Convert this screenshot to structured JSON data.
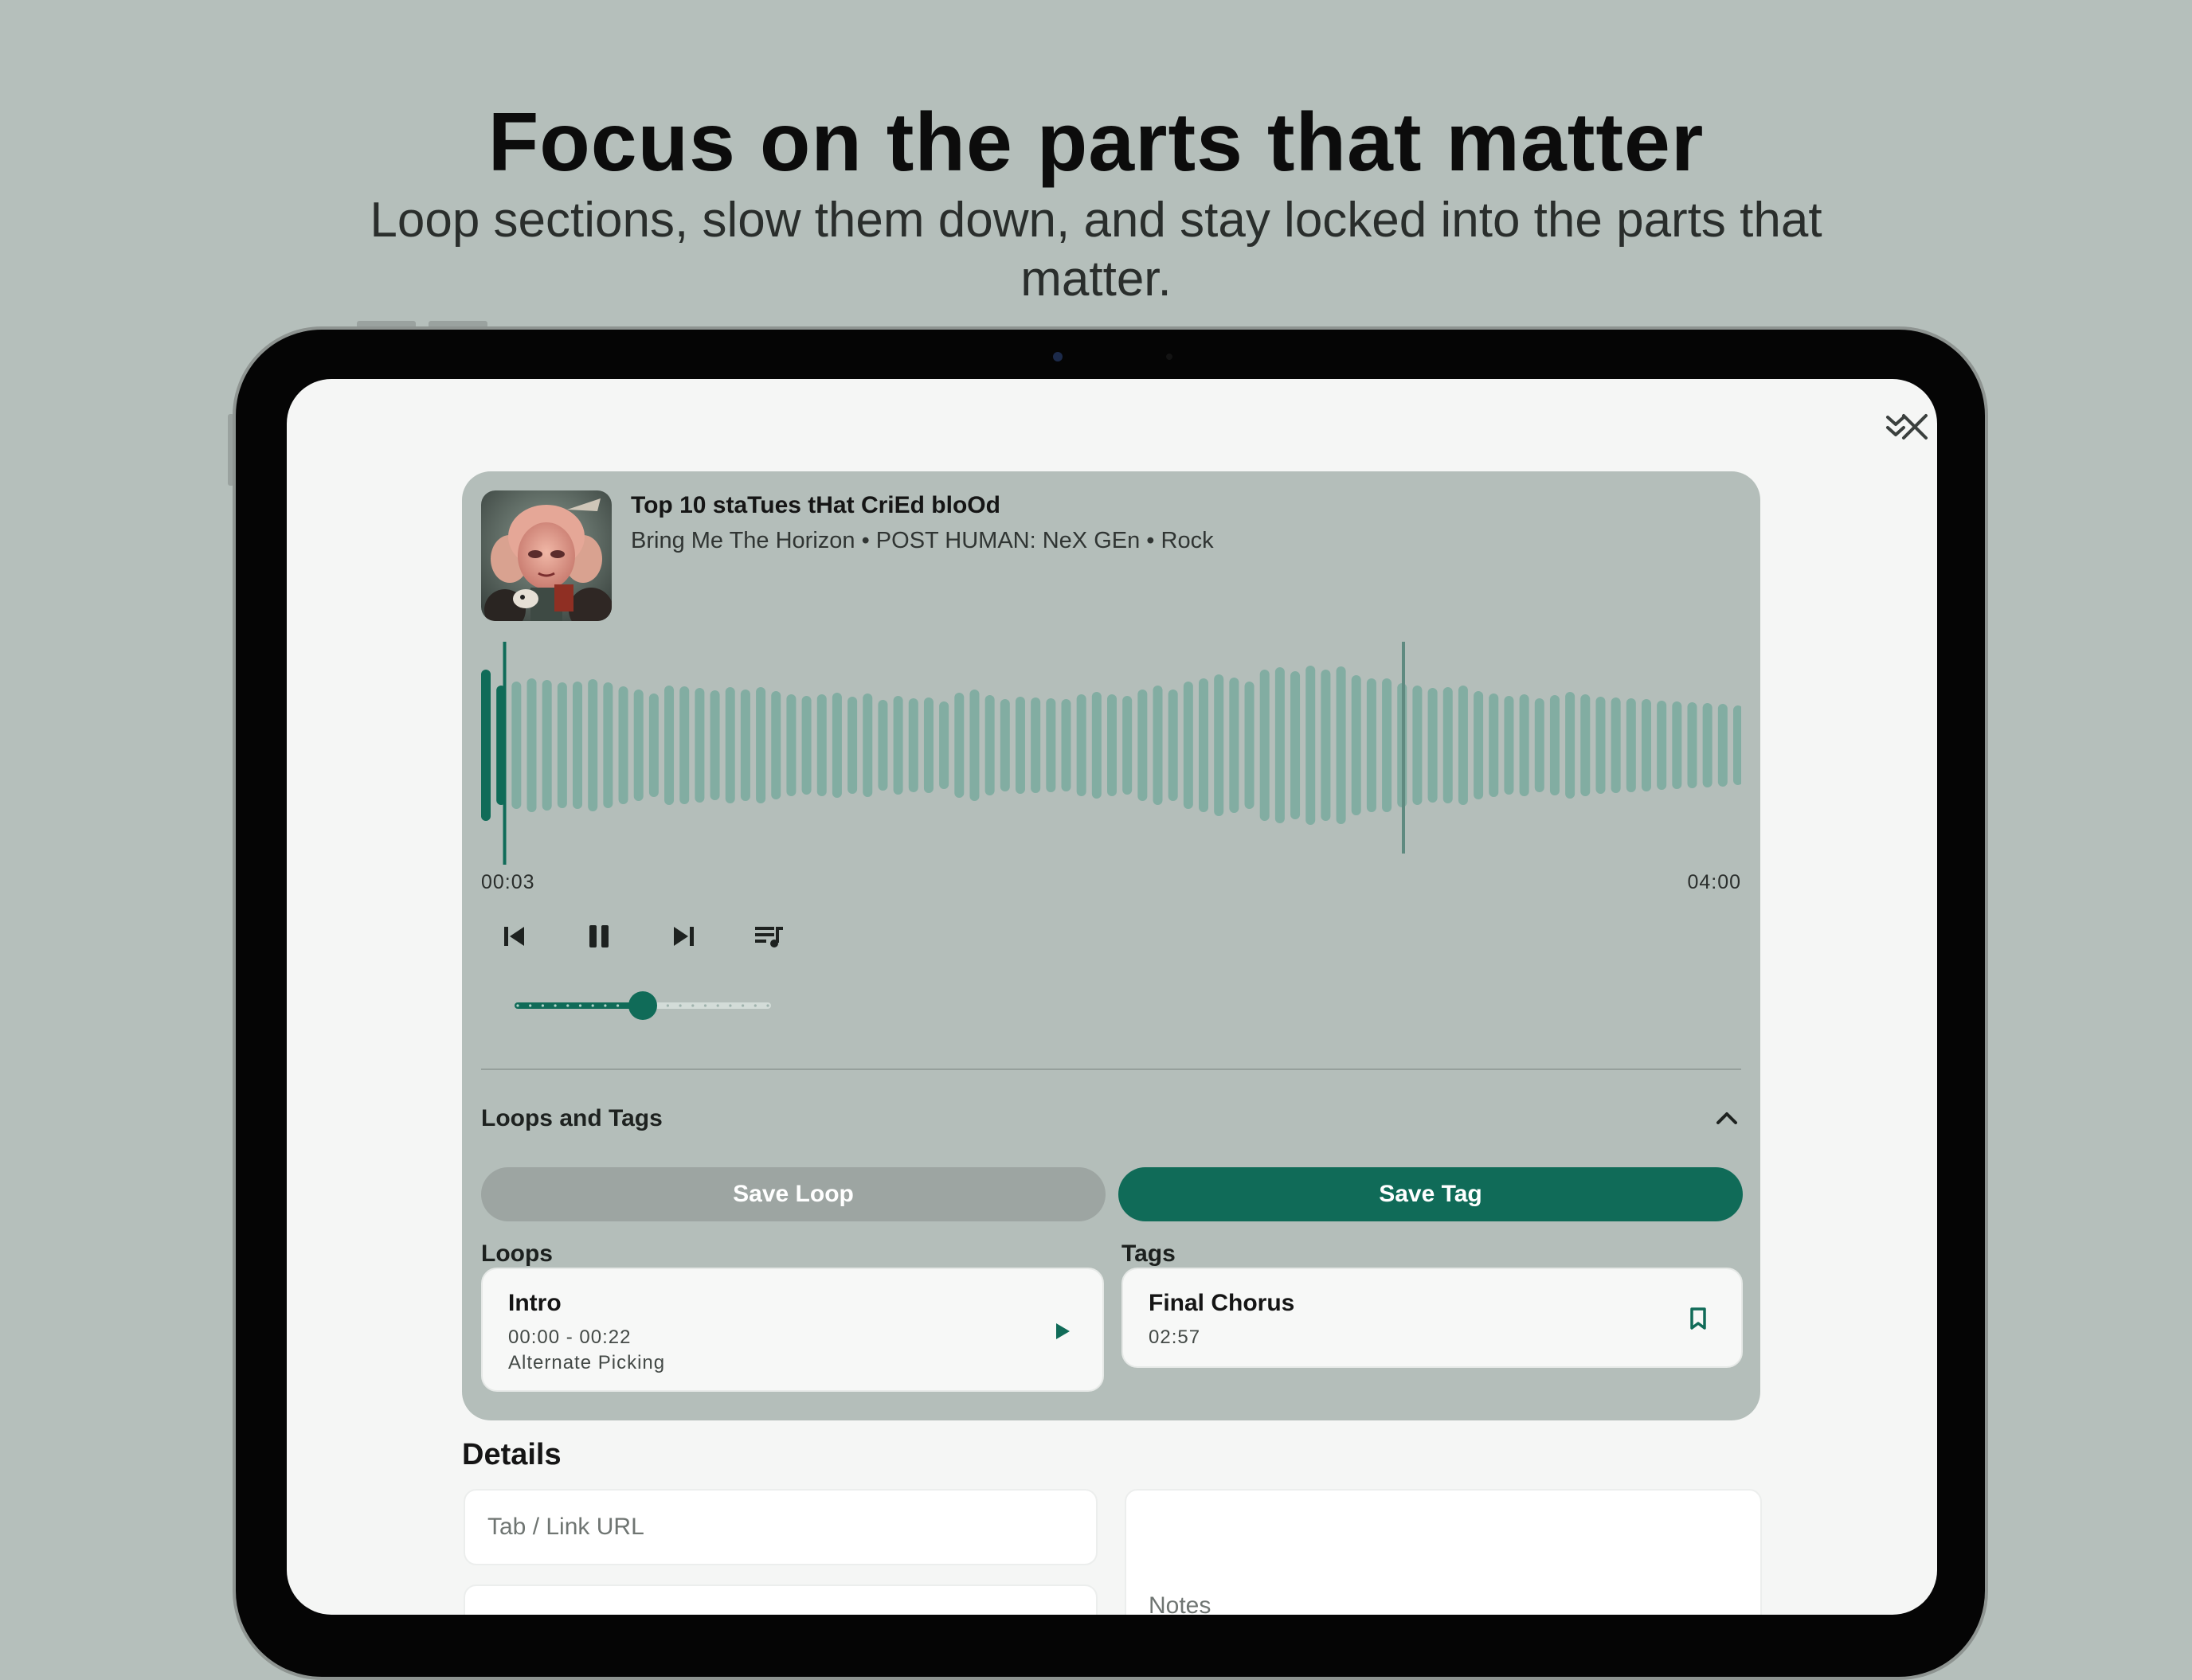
{
  "hero": {
    "headline": "Focus on the parts that matter",
    "subhead": "Loop sections, slow them down, and stay locked into the parts that matter."
  },
  "sheet": {
    "collapse_icon": "double-chevron-down-icon",
    "close_icon": "close-icon"
  },
  "player": {
    "title": "Top 10 staTues tHat CriEd bloOd",
    "meta": "Bring Me The Horizon • POST HUMAN: NeX GEn • Rock",
    "current_time": "00:03",
    "total_time": "04:00",
    "progress_fraction": 0.0125,
    "speed_fraction": 0.5,
    "controls": [
      "skip-previous-icon",
      "pause-icon",
      "skip-next-icon",
      "queue-music-icon"
    ],
    "colors": {
      "accent": "#106b58",
      "wave": "#82ada2",
      "card": "#b4beba"
    }
  },
  "loops_tags": {
    "title": "Loops and Tags",
    "save_loop_label": "Save Loop",
    "save_tag_label": "Save Tag",
    "loops_label": "Loops",
    "tags_label": "Tags",
    "loops": [
      {
        "name": "Intro",
        "range": "00:00 - 00:22",
        "technique": "Alternate Picking"
      }
    ],
    "tags": [
      {
        "name": "Final Chorus",
        "time": "02:57"
      }
    ]
  },
  "details": {
    "title": "Details",
    "url_placeholder": "Tab / Link URL",
    "notes_placeholder": "Notes"
  }
}
